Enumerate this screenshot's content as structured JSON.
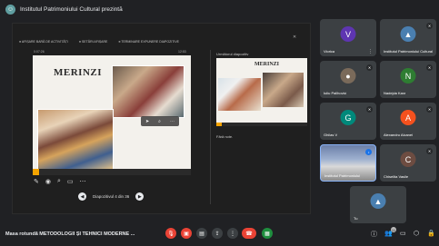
{
  "topbar": {
    "title": "Institutul Patrimoniului Cultural prezintă"
  },
  "presentation": {
    "ribbon": [
      "AFIȘARE BARĂ DE ACTIVITĂȚI",
      "SETĂRI AFIȘARE",
      "TERMINARE EXPUNERE DIAPOZITIVE"
    ],
    "slide_label": "0:07:26",
    "clock": "12:53",
    "slide_title": "MERINZI",
    "tools": [
      "pen-icon",
      "laser-icon",
      "zoom-icon",
      "screen-icon",
      "more-icon"
    ],
    "nav_label": "Diapozitivul 4 din 36",
    "next_label": "Următorul diapozitiv",
    "next_title": "MERINZI",
    "notes": "Fără note."
  },
  "participants": [
    {
      "initial": "V",
      "name": "Viorica",
      "color": "#5e35b1"
    },
    {
      "initial": "",
      "name": "Institutul Patrimoniului Cultural",
      "color": "#4a7fb0"
    },
    {
      "initial": "",
      "name": "Iuliu Pallhovici",
      "color": "#7a6a5a"
    },
    {
      "initial": "N",
      "name": "Nadejda Kara",
      "color": "#2e7d32"
    },
    {
      "initial": "G",
      "name": "Ghilas V",
      "color": "#00897b"
    },
    {
      "initial": "A",
      "name": "Alexandru Alcanei",
      "color": "#f4511e"
    },
    {
      "initial": "",
      "name": "Institutul Patrimoniului",
      "color": "#6b7fa8"
    },
    {
      "initial": "C",
      "name": "Chiselita Vasile",
      "color": "#6d4c41"
    },
    {
      "initial": "",
      "name": "Tu",
      "color": "#4a7fb0"
    }
  ],
  "bottombar": {
    "meeting_title": "Masa rotundă METODOLOGII ȘI TEHNICI MODERNE ...",
    "participant_count": "11"
  }
}
